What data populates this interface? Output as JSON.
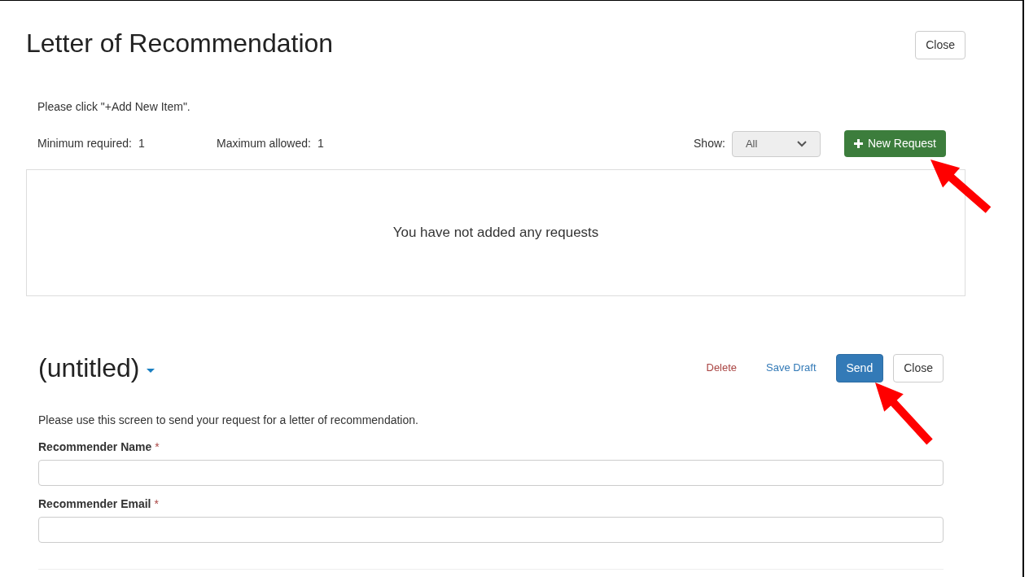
{
  "title": "Letter of Recommendation",
  "close_button": "Close",
  "instruction": "Please click \"+Add New Item\".",
  "limits": [
    {
      "label": "Minimum required:",
      "value": "1"
    },
    {
      "label": "Maximum allowed:",
      "value": "1"
    }
  ],
  "filter": {
    "label": "Show:",
    "value": "All"
  },
  "new_button": "New Request",
  "empty_message": "You have not added any requests",
  "item": {
    "title": "(untitled)",
    "actions": [
      {
        "label": "Delete",
        "kind": "danger-link"
      },
      {
        "label": "Save Draft",
        "kind": "link"
      },
      {
        "label": "Send",
        "kind": "primary"
      },
      {
        "label": "Close",
        "kind": "default"
      }
    ],
    "description": "Please use this screen to send your request for a letter of recommendation.",
    "fields": [
      {
        "label": "Recommender Name",
        "required_mark": "*"
      },
      {
        "label": "Recommender Email",
        "required_mark": "*"
      }
    ]
  }
}
